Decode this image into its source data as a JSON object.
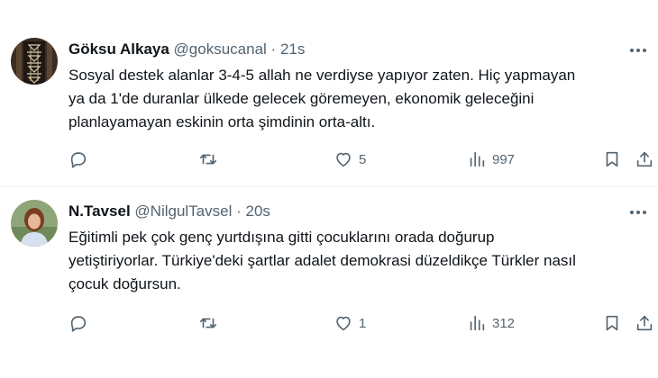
{
  "tweets": [
    {
      "author": "Göksu Alkaya",
      "handle": "@goksucanal",
      "sep": "·",
      "time": "21s",
      "text": "Sosyal destek alanlar 3-4-5 allah ne verdiyse yapıyor zaten.  Hiç yapmayan\nya da 1'de duranlar ülkede gelecek göremeyen, ekonomik geleceğini\nplanlayamayan eskinin orta şimdinin orta-altı.",
      "likes": "5",
      "views": "997"
    },
    {
      "author": "N.Tavsel",
      "handle": "@NilgulTavsel",
      "sep": "·",
      "time": "20s",
      "text": "Eğitimli pek çok genç yurtdışına gitti çocuklarını orada doğurup\nyetiştiriyorlar. Türkiye'deki şartlar adalet demokrasi düzeldikçe Türkler nasıl\nçocuk doğursun.",
      "likes": "1",
      "views": "312"
    }
  ],
  "icons": {
    "reply": "reply-icon",
    "retweet": "retweet-icon",
    "like": "heart-icon",
    "views": "views-icon",
    "bookmark": "bookmark-icon",
    "share": "share-icon",
    "more": "more-icon"
  },
  "colors": {
    "text": "#0f1419",
    "muted": "#536471",
    "divider": "#eff3f4"
  }
}
